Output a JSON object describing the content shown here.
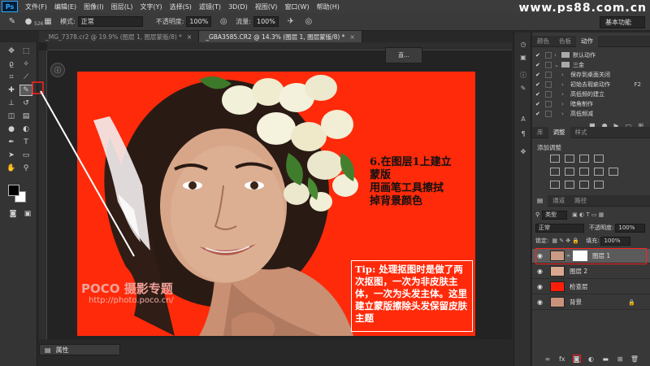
{
  "app": {
    "logo": "Ps",
    "watermark": "www.ps88.com.cn"
  },
  "menu": [
    "文件(F)",
    "编辑(E)",
    "图像(I)",
    "图层(L)",
    "文字(Y)",
    "选择(S)",
    "滤镜(T)",
    "3D(D)",
    "视图(V)",
    "窗口(W)",
    "帮助(H)"
  ],
  "options": {
    "brush_size": "526",
    "mode_label": "模式:",
    "mode_value": "正常",
    "opacity_label": "不透明度:",
    "opacity_value": "100%",
    "flow_label": "流量:",
    "flow_value": "100%",
    "workspace": "基本功能"
  },
  "tabs": [
    {
      "label": "_MG_7378.cr2 @ 19.9% (图层 1, 图层蒙版/8) *",
      "close": "×"
    },
    {
      "label": "_GBA3585.CR2 @ 14.3% (图层 1, 图层蒙版/8) *",
      "close": "×"
    }
  ],
  "float_panel": "直...",
  "document": {
    "step_lines": [
      "6.在图层1上建立",
      "蒙版",
      "用画笔工具擦拭",
      "掉背景颜色"
    ],
    "tip": "Tip: 处理抠图时是做了两次抠图，一次为非皮肤主体，一次为头发主体。这里建立蒙版擦除头发保留皮肤主题",
    "poco_logo": "POCO 摄影专题",
    "poco_url": "http://photo.poco.cn/"
  },
  "properties": {
    "label": "属性"
  },
  "panel": {
    "tabs_top": [
      "颜色",
      "色板",
      "动作"
    ],
    "actions": [
      {
        "type": "folder",
        "label": "默认动作",
        "key": ""
      },
      {
        "type": "folder",
        "label": "三金",
        "key": ""
      },
      {
        "type": "item",
        "label": "保存到桌面关闭",
        "key": ""
      },
      {
        "type": "item",
        "label": "初始去瑕疵动作",
        "key": "F2"
      },
      {
        "type": "item",
        "label": "高低频的建立",
        "key": ""
      },
      {
        "type": "item",
        "label": "暗角制作",
        "key": ""
      },
      {
        "type": "item",
        "label": "高低频减",
        "key": ""
      }
    ],
    "tabs_mid": [
      "库",
      "调整",
      "样式"
    ],
    "adjust_title": "添加调整",
    "tabs_layers": [
      "通道",
      "路径"
    ],
    "kind_label": "类型",
    "blend_mode": "正常",
    "opacity_label": "不透明度:",
    "opacity_value": "100%",
    "lock_label": "锁定:",
    "fill_label": "填充:",
    "fill_value": "100%",
    "layers": [
      {
        "name": "图层 1",
        "selected": true,
        "thumb": "#c99b84",
        "mask": true
      },
      {
        "name": "图层 2",
        "selected": false,
        "thumb": "#d9a88f",
        "mask": false
      },
      {
        "name": "检查层",
        "selected": false,
        "thumb": "#ff1e0a",
        "mask": false
      },
      {
        "name": "背景",
        "selected": false,
        "thumb": "#c9937b",
        "mask": false,
        "locked": true
      }
    ]
  },
  "colors": {
    "background_red": "#ff2a0a",
    "highlight": "#ff2020"
  }
}
